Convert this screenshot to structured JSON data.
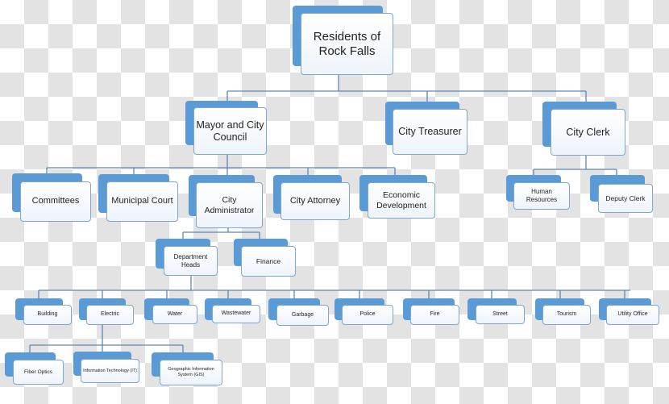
{
  "colors": {
    "box_back": "#5b9bd5",
    "box_border": "#7ea6d3",
    "connector": "#5b87b8"
  },
  "nodes": {
    "residents": "Residents of Rock Falls",
    "mayor": "Mayor and City Council",
    "treasurer": "City Treasurer",
    "clerk": "City Clerk",
    "committees": "Committees",
    "court": "Municipal Court",
    "administrator": "City Administrator",
    "attorney": "City Attorney",
    "economic": "Economic Development",
    "hr": "Human Resources",
    "deputy": "Deputy Clerk",
    "deptheads": "Department Heads",
    "finance": "Finance",
    "building": "Building",
    "electric": "Electric",
    "water": "Water",
    "wastewater": "Wastewater",
    "garbage": "Garbage",
    "police": "Police",
    "fire": "Fire",
    "street": "Street",
    "tourism": "Tourism",
    "utility": "Utility Office",
    "fiber": "Fiber Optics",
    "it": "Information Technology (IT)",
    "gis": "Geographic Information System (GIS)"
  }
}
